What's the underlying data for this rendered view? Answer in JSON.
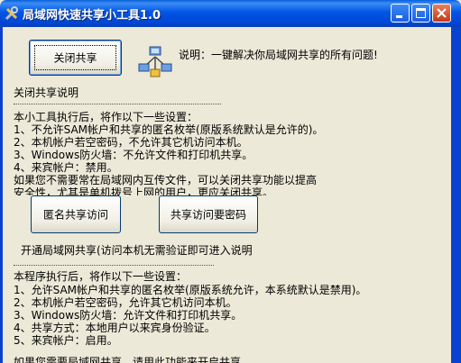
{
  "window": {
    "title": "局域网快速共享小工具1.0",
    "icon": "tools-icon",
    "controls": [
      "minimize-icon",
      "maximize-icon",
      "close-icon"
    ]
  },
  "top": {
    "close_share_button": "关闭共享",
    "description": "说明：一键解决你局域网共享的所有问题!",
    "network_icon": "network-sharing-icon"
  },
  "close_section": {
    "heading": "关闭共享说明",
    "lines": [
      "本小工具执行后，将作以下一些设置：",
      "1、不允许SAM帐户和共享的匿名枚举(原版系统默认是允许的)。",
      "2、本机帐户若空密码，不允许其它机访问本机。",
      "3、Windows防火墙：不允许文件和打印机共享。",
      "4、来宾帐户：禁用。",
      " 如果您不需要常在局域网内互传文件，可以关闭共享功能以提高",
      "安全性，尤其是单机拨号上网的用户，更应关闭共享。"
    ]
  },
  "buttons": {
    "anonymous_access": "匿名共享访问",
    "password_access": "共享访问要密码"
  },
  "open_section": {
    "heading": "开通局域网共享(访问本机无需验证即可进入说明",
    "lines": [
      "本程序执行后，将作以下一些设置：",
      "1、允许SAM帐户和共享的匿名枚举(原版系统允许，本系统默认是禁用)。",
      "2、本机帐户若空密码，允许其它机访问本机。",
      "3、Windows防火墙：允许文件和打印机共享。",
      "4、共享方式：本地用户以来宾身份验证。",
      "5、来宾帐户：启用。",
      "如果您需要局域网共享，请用此功能来开启共享。"
    ]
  },
  "colors": {
    "titlebar": "#0055e5",
    "window_bg": "#ece9d8",
    "button_border": "#003c74"
  }
}
